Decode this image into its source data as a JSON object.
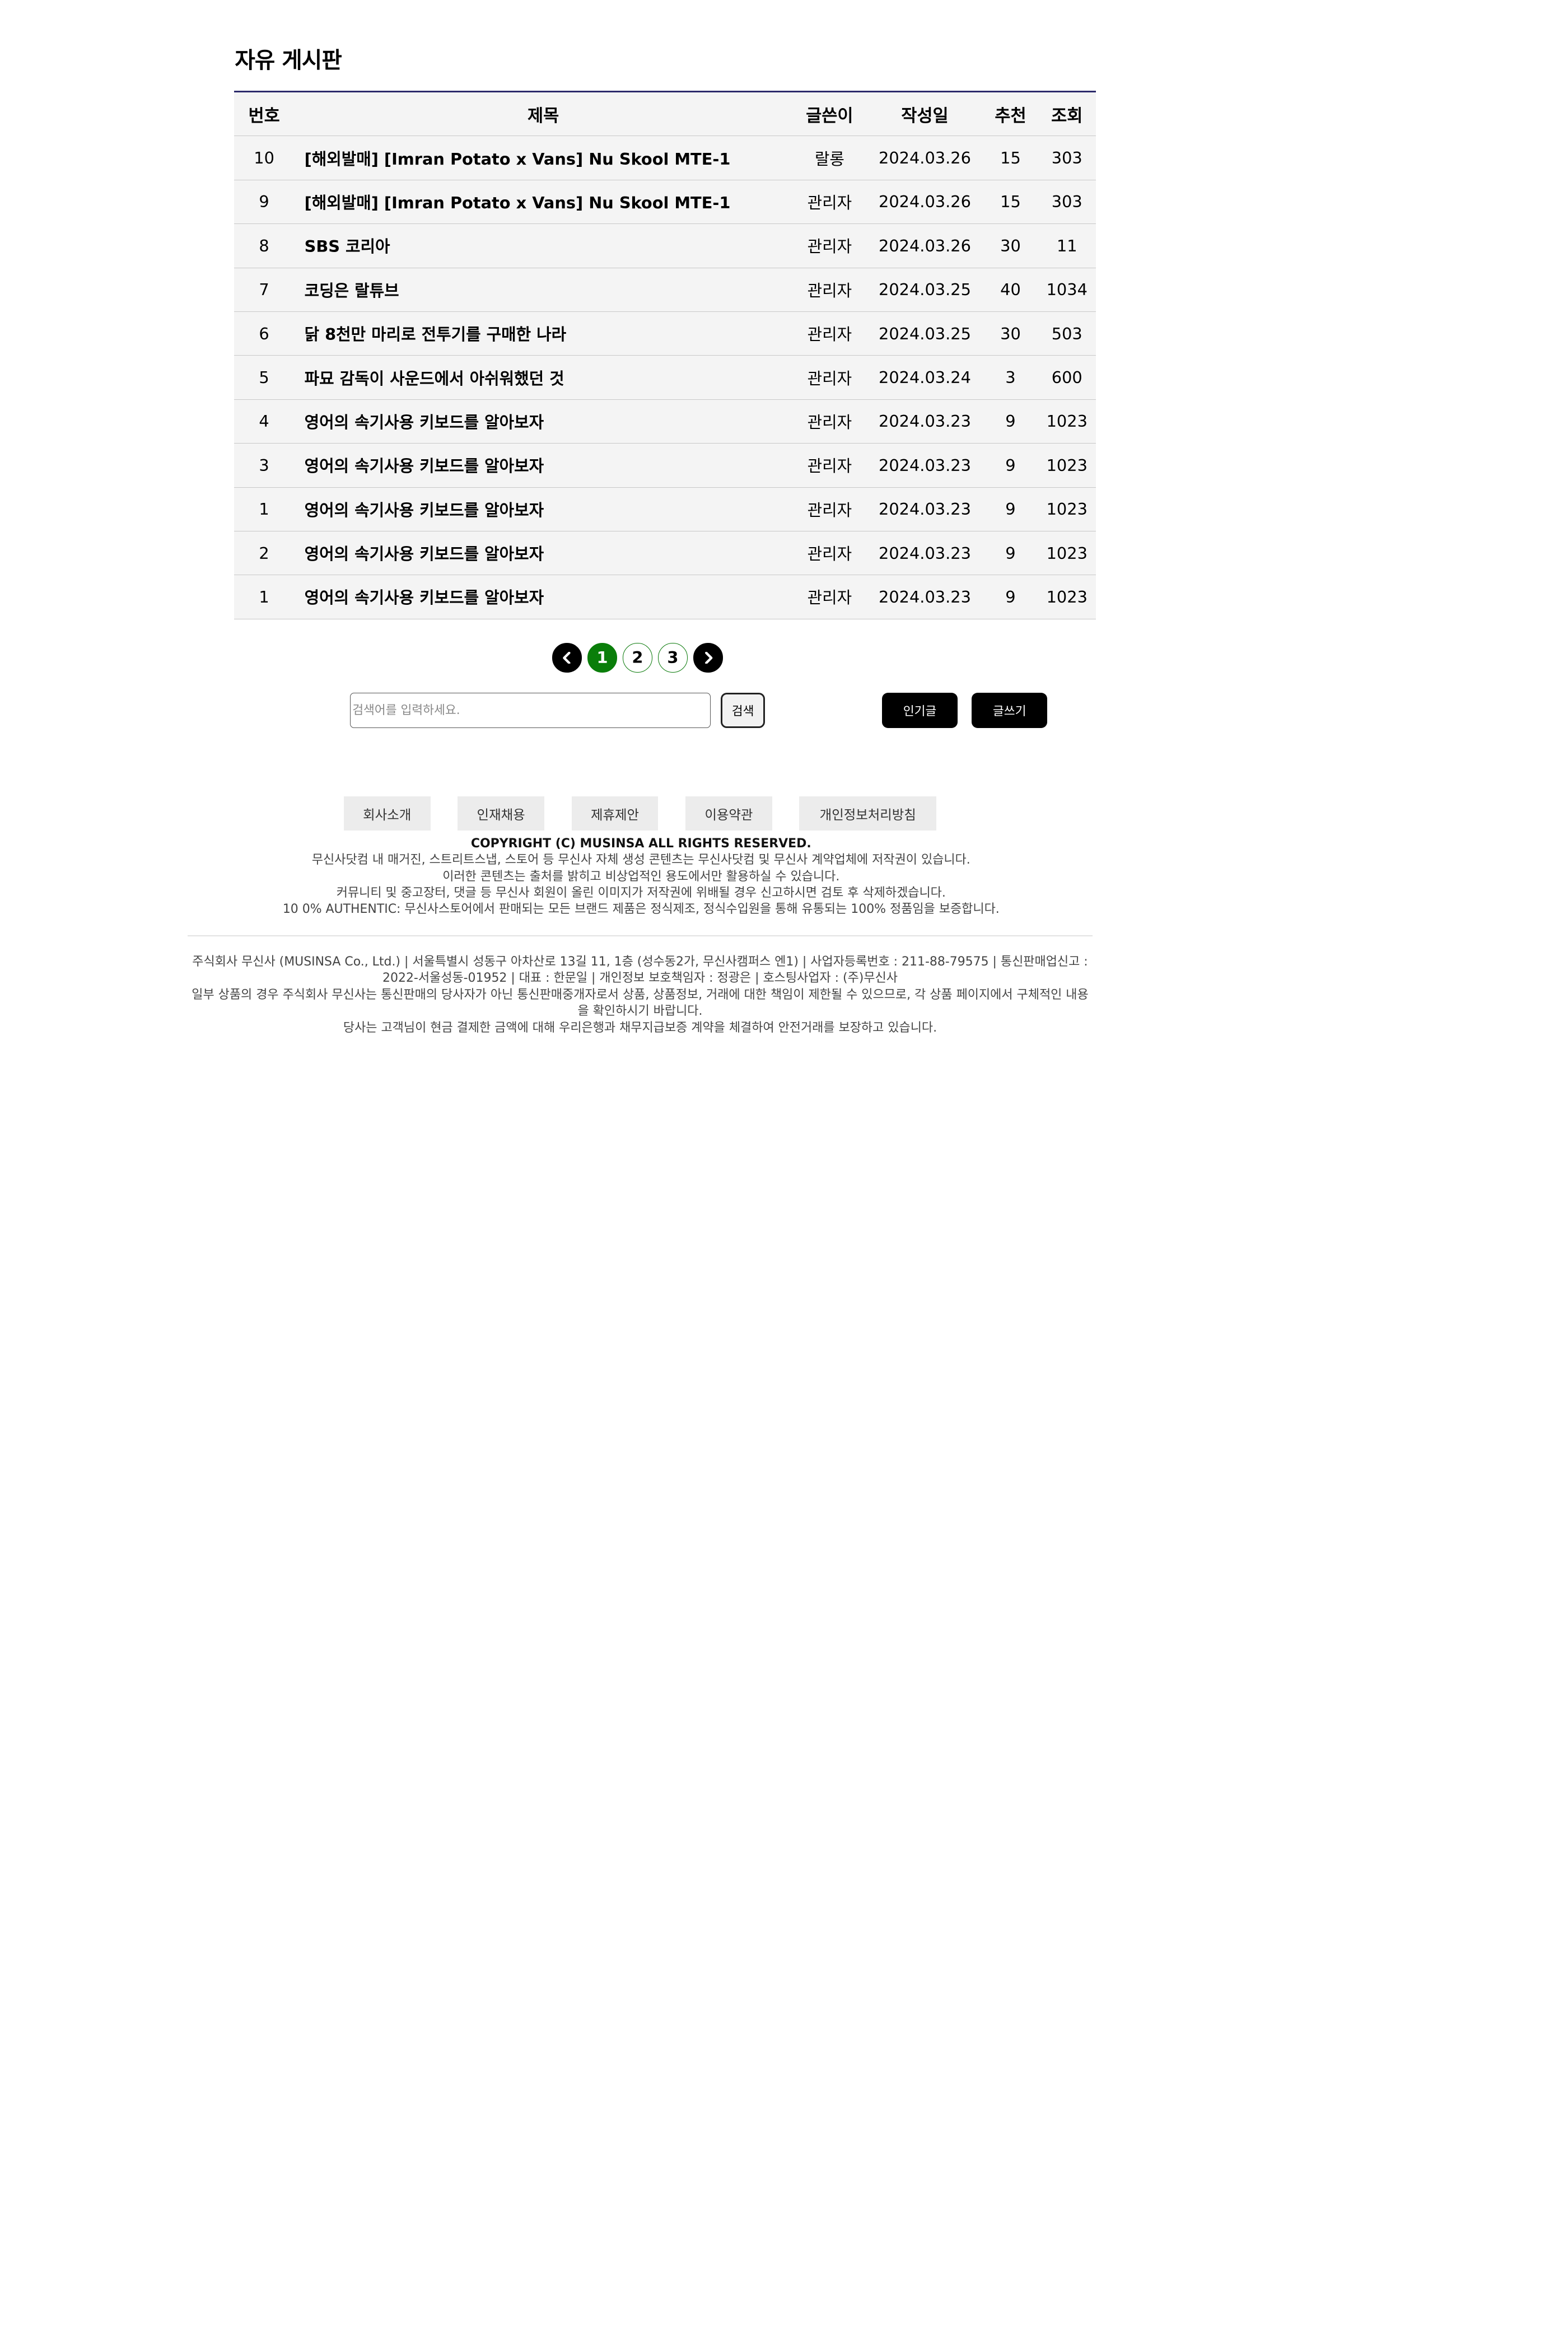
{
  "board": {
    "title": "자유 게시판",
    "headers": {
      "no": "번호",
      "title": "제목",
      "author": "글쓴이",
      "date": "작성일",
      "likes": "추천",
      "views": "조회"
    },
    "rows": [
      {
        "no": "10",
        "title": "[해외발매] [Imran Potato x Vans] Nu Skool MTE-1",
        "author": "랄롱",
        "date": "2024.03.26",
        "likes": "15",
        "views": "303"
      },
      {
        "no": "9",
        "title": "[해외발매] [Imran Potato x Vans] Nu Skool MTE-1",
        "author": "관리자",
        "date": "2024.03.26",
        "likes": "15",
        "views": "303"
      },
      {
        "no": "8",
        "title": "SBS 코리아",
        "author": "관리자",
        "date": "2024.03.26",
        "likes": "30",
        "views": "11"
      },
      {
        "no": "7",
        "title": "코딩은 랄튜브",
        "author": "관리자",
        "date": "2024.03.25",
        "likes": "40",
        "views": "1034"
      },
      {
        "no": "6",
        "title": "닭 8천만 마리로 전투기를 구매한 나라",
        "author": "관리자",
        "date": "2024.03.25",
        "likes": "30",
        "views": "503"
      },
      {
        "no": "5",
        "title": "파묘 감독이 사운드에서 아쉬워했던 것",
        "author": "관리자",
        "date": "2024.03.24",
        "likes": "3",
        "views": "600"
      },
      {
        "no": "4",
        "title": "영어의 속기사용 키보드를 알아보자",
        "author": "관리자",
        "date": "2024.03.23",
        "likes": "9",
        "views": "1023"
      },
      {
        "no": "3",
        "title": "영어의 속기사용 키보드를 알아보자",
        "author": "관리자",
        "date": "2024.03.23",
        "likes": "9",
        "views": "1023"
      },
      {
        "no": "1",
        "title": "영어의 속기사용 키보드를 알아보자",
        "author": "관리자",
        "date": "2024.03.23",
        "likes": "9",
        "views": "1023"
      },
      {
        "no": "2",
        "title": "영어의 속기사용 키보드를 알아보자",
        "author": "관리자",
        "date": "2024.03.23",
        "likes": "9",
        "views": "1023"
      },
      {
        "no": "1",
        "title": "영어의 속기사용 키보드를 알아보자",
        "author": "관리자",
        "date": "2024.03.23",
        "likes": "9",
        "views": "1023"
      }
    ]
  },
  "pagination": {
    "prev_icon": "chevron-left-icon",
    "next_icon": "chevron-right-icon",
    "pages": [
      "1",
      "2",
      "3"
    ],
    "current": "1",
    "active_color": "#0a7e0a"
  },
  "search": {
    "value": "",
    "placeholder": "검색어를 입력하세요.",
    "button_label": "검색"
  },
  "actions": {
    "popular_label": "인기글",
    "write_label": "글쓰기"
  },
  "footer": {
    "links": [
      "회사소개",
      "인재채용",
      "제휴제안",
      "이용약관",
      "개인정보처리방침"
    ],
    "copyright_title": "COPYRIGHT (C) MUSINSA ALL RIGHTS RESERVED.",
    "notices": [
      "무신사닷컴 내 매거진, 스트리트스냅, 스토어 등 무신사 자체 생성 콘텐츠는 무신사닷컴 및 무신사 계약업체에 저작권이 있습니다.",
      "이러한 콘텐츠는 출처를 밝히고 비상업적인 용도에서만 활용하실 수 있습니다.",
      "커뮤니티 및 중고장터, 댓글 등 무신사 회원이 올린 이미지가 저작권에 위배될 경우 신고하시면 검토 후 삭제하겠습니다.",
      "10 0% AUTHENTIC: 무신사스토어에서 판매되는 모든 브랜드 제품은 정식제조, 정식수입원을 통해 유통되는 100% 정품임을 보증합니다."
    ],
    "company_lines": [
      "주식회사 무신사 (MUSINSA Co., Ltd.) | 서울특별시 성동구 아차산로 13길 11, 1층 (성수동2가, 무신사캠퍼스 엔1) | 사업자등록번호 : 211-88-79575 | 통신판매업신고 : 2022-서울성동-01952 | 대표 : 한문일 | 개인정보 보호책임자 : 정광은 | 호스팅사업자 : (주)무신사",
      "일부 상품의 경우 주식회사 무신사는 통신판매의 당사자가 아닌 통신판매중개자로서 상품, 상품정보, 거래에 대한 책임이 제한될 수 있으므로, 각 상품 페이지에서 구체적인 내용을 확인하시기 바랍니다.",
      "당사는 고객님이 현금 결제한 금액에 대해 우리은행과 채무지급보증 계약을 체결하여 안전거래를 보장하고 있습니다."
    ]
  }
}
